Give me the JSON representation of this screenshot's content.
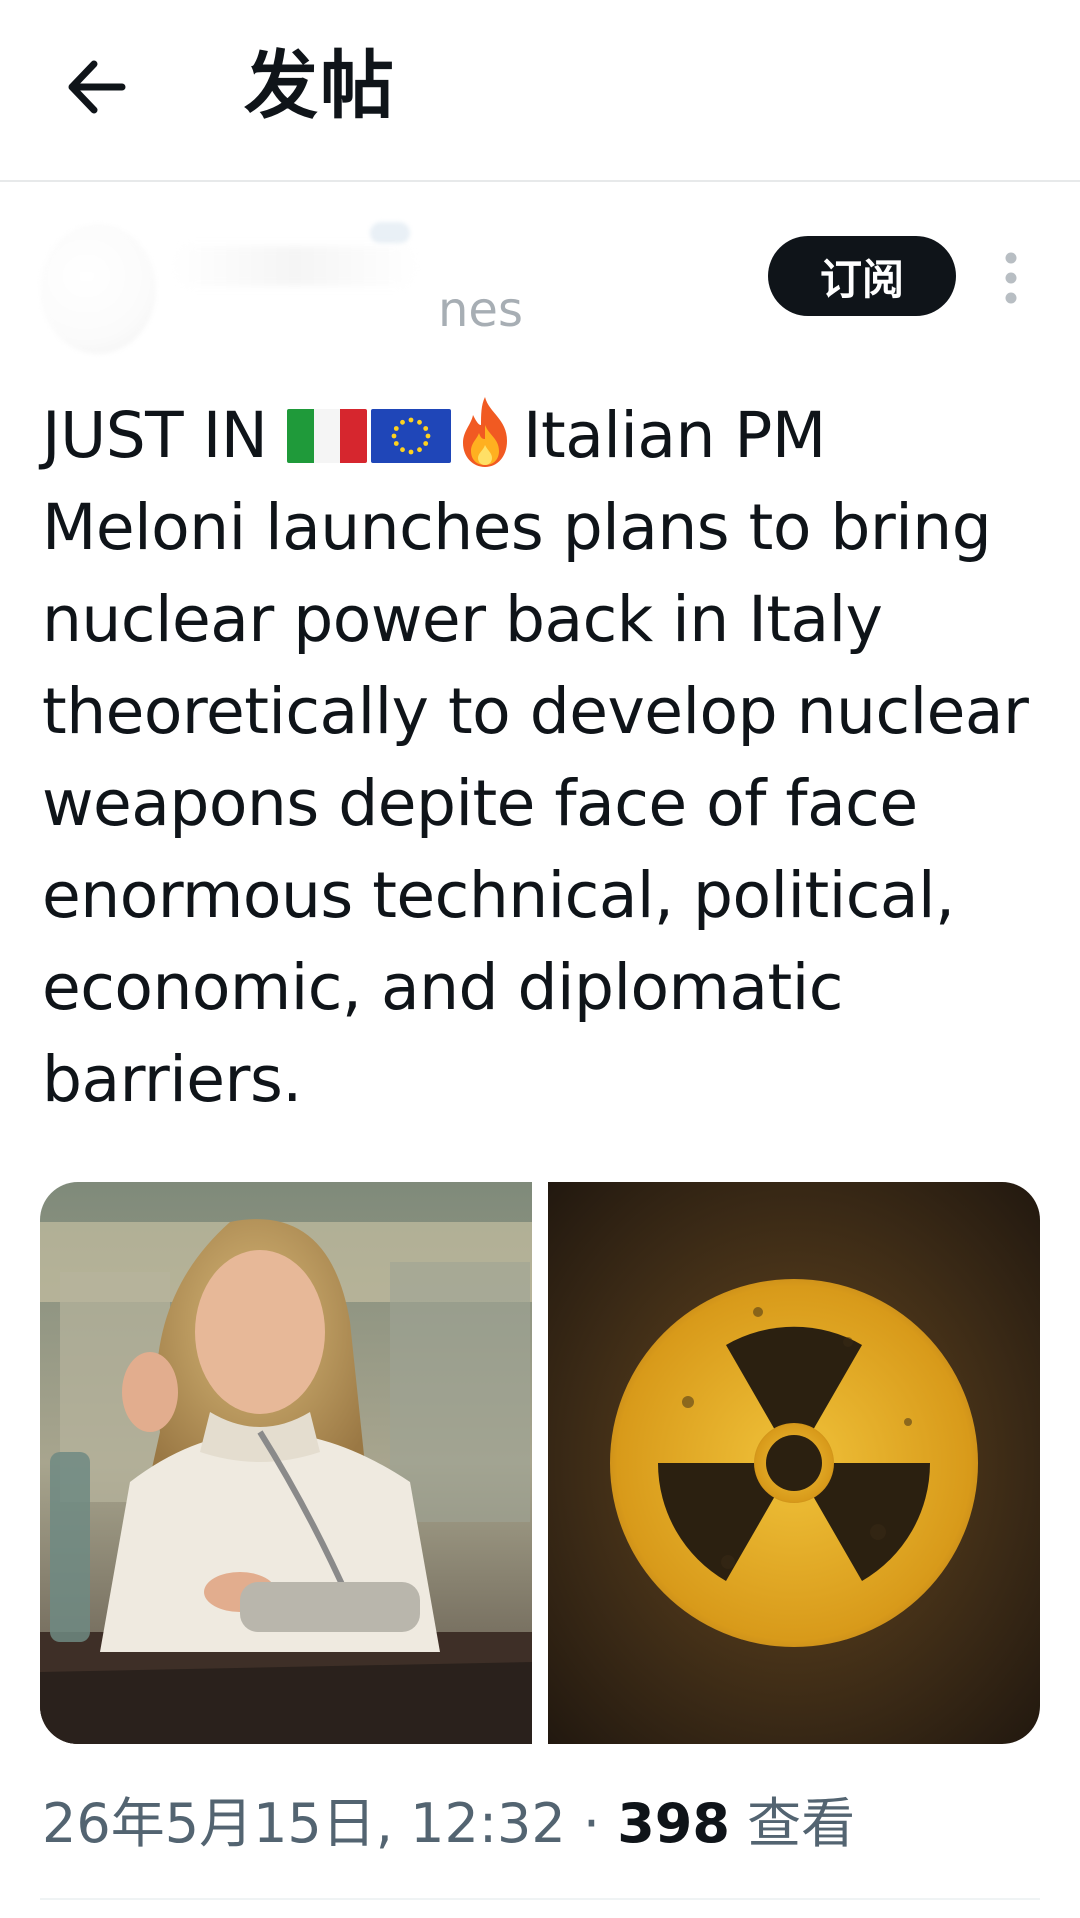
{
  "header": {
    "title": "发帖",
    "back_icon": "arrow-left-icon"
  },
  "author": {
    "handle_fragment": "nes"
  },
  "actions": {
    "subscribe_label": "订阅",
    "more_icon": "vertical-ellipsis-icon"
  },
  "tweet": {
    "prefix": "JUST IN ",
    "emojis": [
      "italy-flag-icon",
      "eu-flag-icon",
      "fire-icon"
    ],
    "body": "Italian PM Meloni launches plans to bring nuclear power back in Italy theoretically to develop nuclear weapons depite face of face enormous technical, political, economic, and diplomatic barriers."
  },
  "media": [
    {
      "name": "meloni-photo",
      "description_icon": "person-photo"
    },
    {
      "name": "radiation-symbol-image",
      "description_icon": "radiation-icon"
    }
  ],
  "meta": {
    "datetime": "26年5月15日, 12:32",
    "separator": " · ",
    "views_count": "398",
    "views_label": " 查看"
  },
  "colors": {
    "text": "#0f1419",
    "muted": "#536471",
    "button_bg": "#0f1419",
    "divider": "#e7e9ea"
  }
}
